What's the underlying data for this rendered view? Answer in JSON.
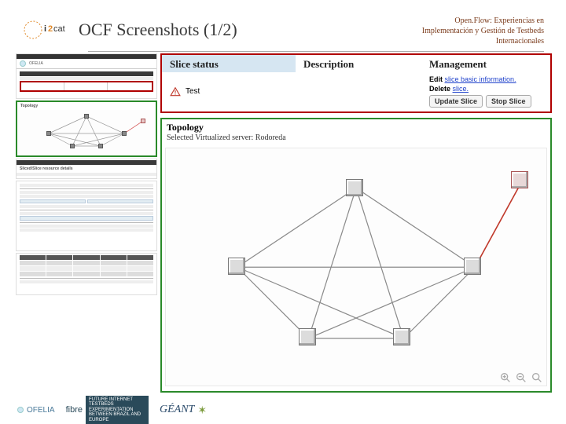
{
  "header": {
    "logo_name": "i2cat",
    "title": "OCF Screenshots (1/2)",
    "subtitle": "Open.Flow: Experiencias en Implementación y Gestión de Testbeds Internacionales"
  },
  "zoom_info": {
    "columns": {
      "status": "Slice status",
      "description": "Description",
      "management": "Management"
    },
    "status_text": "Test",
    "description_text": "",
    "mgmt_line1_prefix": "Edit",
    "mgmt_line1_link": "slice basic information.",
    "mgmt_line2_prefix": "Delete",
    "mgmt_line2_link": "slice.",
    "buttons": {
      "update": "Update Slice",
      "stop": "Stop Slice"
    }
  },
  "zoom_topology": {
    "title": "Topology",
    "subtitle": "Selected Virtualized server: Rodoreda"
  },
  "thumbs": {
    "brand": "OFELIA",
    "section_topology": "Topology",
    "section_resources": "Sliced/Slice resource details"
  },
  "footer": {
    "ofelia": "OFELIA",
    "fibre": "fibre",
    "fibre_sub": "FUTURE INTERNET TESTBEDS EXPERIMENTATION BETWEEN BRAZIL AND EUROPE",
    "geant": "GÉANT"
  }
}
